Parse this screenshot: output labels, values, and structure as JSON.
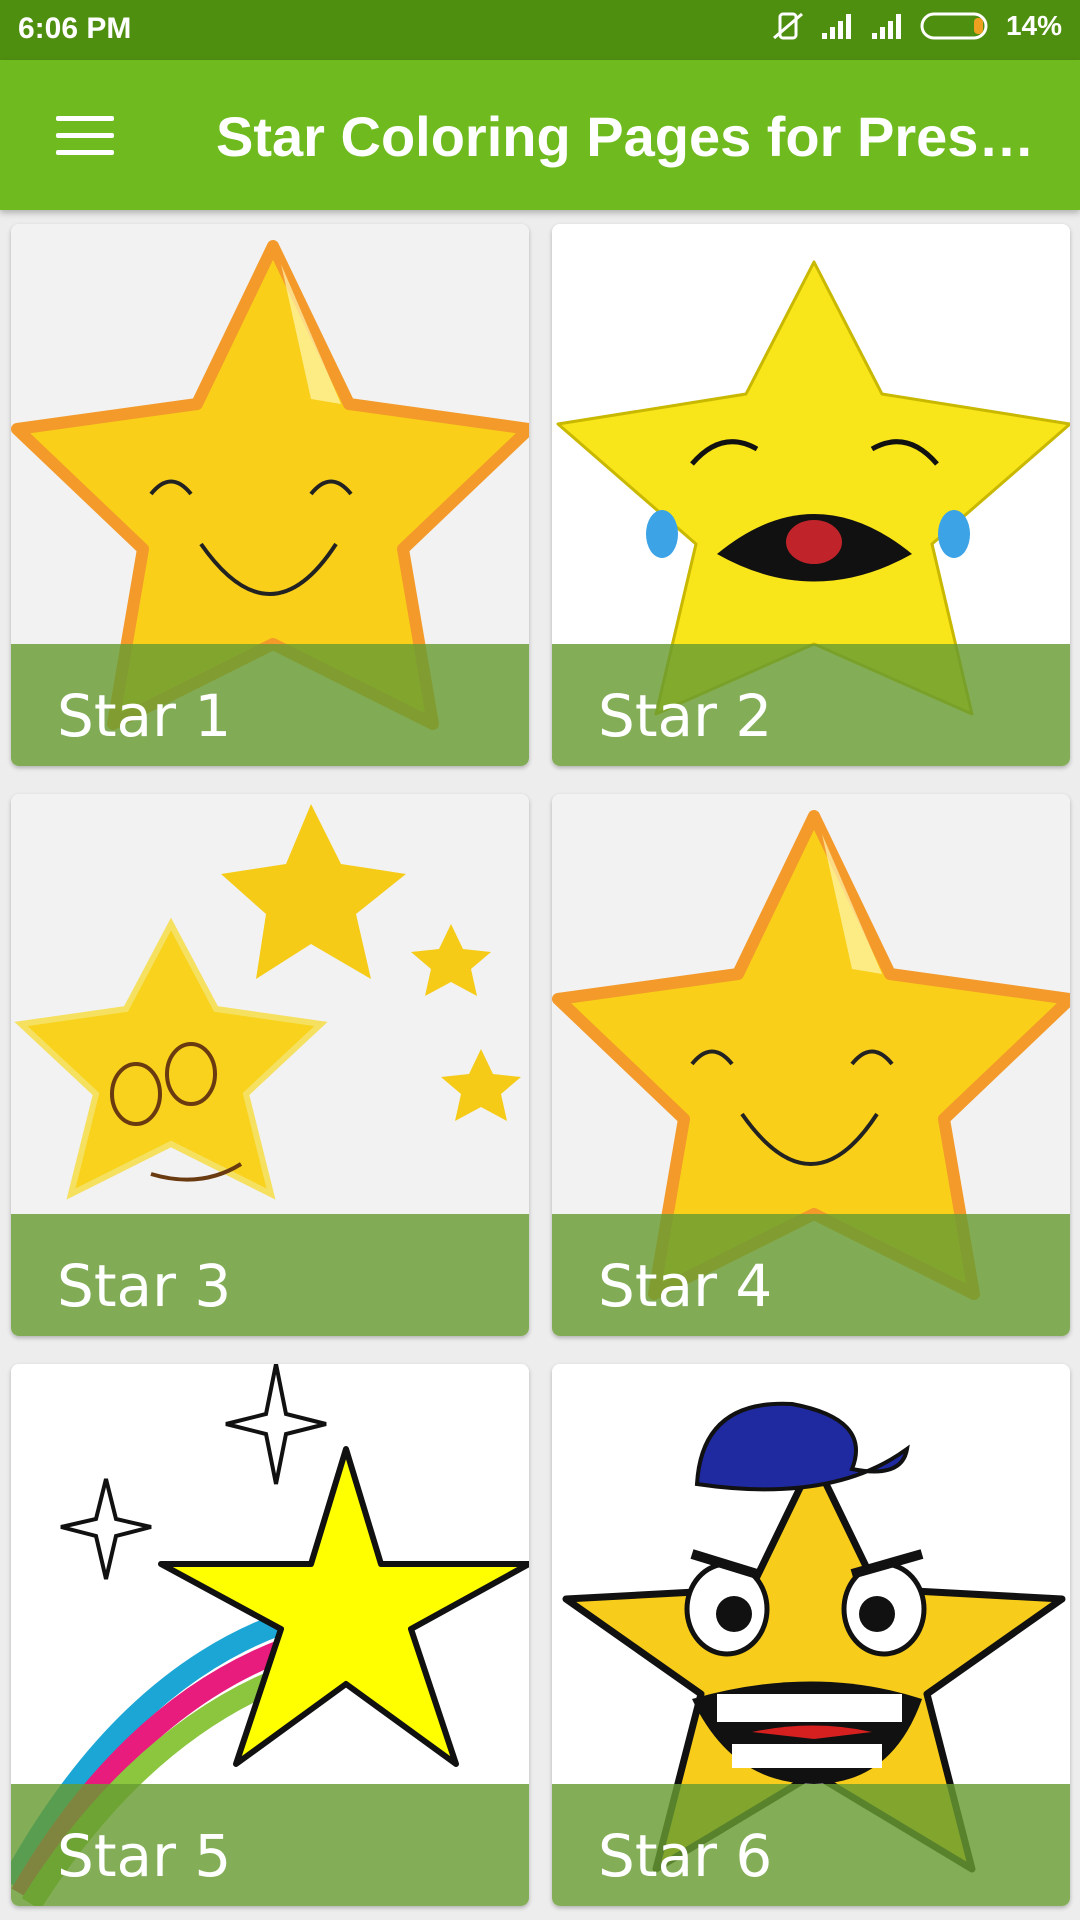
{
  "status": {
    "time": "6:06 PM",
    "battery": "14%"
  },
  "appbar": {
    "title": "Star Coloring Pages for Presc..."
  },
  "cards": [
    {
      "label": "Star 1"
    },
    {
      "label": "Star 2"
    },
    {
      "label": "Star 3"
    },
    {
      "label": "Star 4"
    },
    {
      "label": "Star 5"
    },
    {
      "label": "Star 6"
    }
  ],
  "colors": {
    "statusbar": "#4f8f10",
    "appbar": "#6fbb1f",
    "caption": "#689c32"
  }
}
